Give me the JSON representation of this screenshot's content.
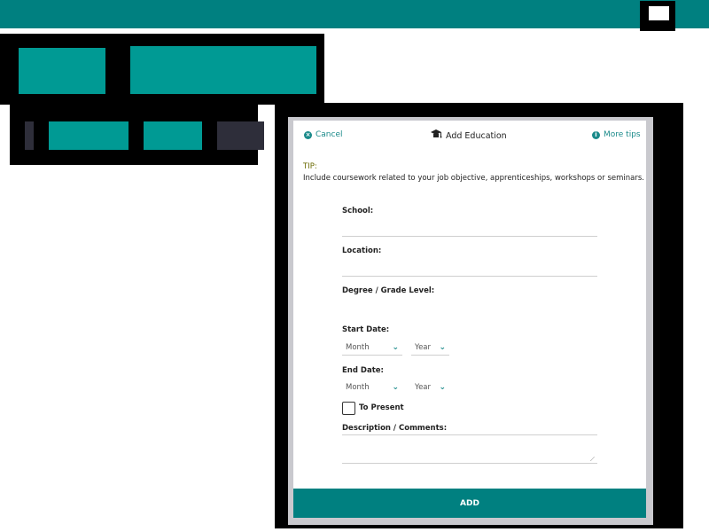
{
  "modal": {
    "cancel_label": "Cancel",
    "title": "Add Education",
    "more_tips_label": "More tips",
    "tip_label": "TIP:",
    "tip_text": "Include coursework related to your job objective, apprenticeships, workshops or seminars.",
    "fields": {
      "school_label": "School:",
      "location_label": "Location:",
      "degree_label": "Degree / Grade Level:",
      "start_date_label": "Start Date:",
      "end_date_label": "End Date:",
      "to_present_label": "To Present",
      "description_label": "Description / Comments:"
    },
    "selects": {
      "month_placeholder": "Month",
      "year_placeholder": "Year"
    },
    "add_label": "ADD"
  },
  "icons": {
    "cancel": "cancel-circle-icon",
    "add_education": "graduation-cap-icon",
    "more_tips": "info-icon",
    "dropdown": "chevron-down-icon"
  },
  "colors": {
    "accent": "#008080",
    "accent_light": "#009a94",
    "link": "#1a8a8a"
  }
}
